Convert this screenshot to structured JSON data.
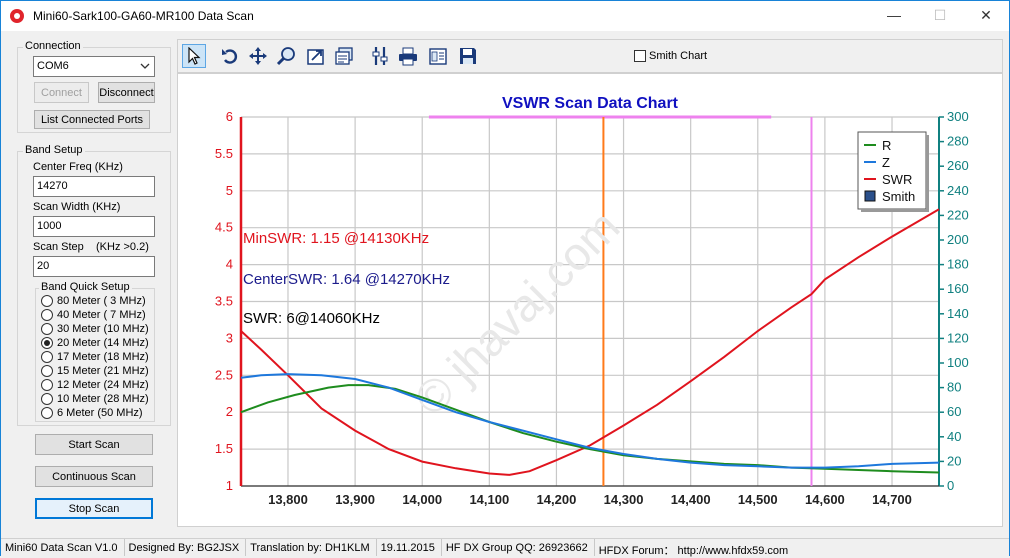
{
  "window": {
    "title": "Mini60-Sark100-GA60-MR100 Data Scan",
    "minimize_glyph": "—",
    "maximize_glyph": "☐",
    "close_glyph": "✕"
  },
  "connection": {
    "group_title": "Connection",
    "port_value": "COM6",
    "connect_label": "Connect",
    "disconnect_label": "Disconnect",
    "list_ports_label": "List Connected Ports"
  },
  "band_setup": {
    "group_title": "Band Setup",
    "center_freq_label": "Center Freq  (KHz)",
    "center_freq_value": "14270",
    "scan_width_label": "Scan Width   (KHz)",
    "scan_width_value": "1000",
    "scan_step_label": "Scan Step",
    "scan_step_hint": "(KHz >0.2)",
    "scan_step_value": "20",
    "quick_title": "Band Quick Setup",
    "bands": [
      {
        "label": "80 Meter (  3 MHz)",
        "selected": false
      },
      {
        "label": "40 Meter (  7 MHz)",
        "selected": false
      },
      {
        "label": "30 Meter (10 MHz)",
        "selected": false
      },
      {
        "label": "20 Meter (14 MHz)",
        "selected": true
      },
      {
        "label": "17 Meter (18 MHz)",
        "selected": false
      },
      {
        "label": "15 Meter (21 MHz)",
        "selected": false
      },
      {
        "label": "12 Meter (24 MHz)",
        "selected": false
      },
      {
        "label": "10 Meter (28 MHz)",
        "selected": false
      },
      {
        "label": "6 Meter  (50 MHz)",
        "selected": false
      }
    ]
  },
  "actions": {
    "start_scan": "Start Scan",
    "continuous_scan": "Continuous Scan",
    "stop_scan": "Stop Scan"
  },
  "toolbar": {
    "icons": [
      "pointer-icon",
      "undo-icon",
      "pan-icon",
      "zoom-icon",
      "export-icon",
      "properties-icon",
      "tools-icon",
      "print-icon",
      "page-setup-icon",
      "save-icon"
    ],
    "smith_chart_label": "Smith Chart",
    "smith_chart_checked": false
  },
  "chart_data": {
    "type": "line",
    "title": "VSWR Scan Data Chart",
    "title_color": "#1010c0",
    "xlim": [
      13730,
      14770
    ],
    "x_ticks": [
      "13,800",
      "13,900",
      "14,000",
      "14,100",
      "14,200",
      "14,300",
      "14,400",
      "14,500",
      "14,600",
      "14,700"
    ],
    "x_tick_values": [
      13800,
      13900,
      14000,
      14100,
      14200,
      14300,
      14400,
      14500,
      14600,
      14700
    ],
    "y_left_lim": [
      1,
      6
    ],
    "y_left_ticks": [
      "1",
      "1.5",
      "2",
      "2.5",
      "3",
      "3.5",
      "4",
      "4.5",
      "5",
      "5.5",
      "6"
    ],
    "y_left_color": "#e0141e",
    "y_right_lim": [
      0,
      300
    ],
    "y_right_ticks": [
      "0",
      "20",
      "40",
      "60",
      "80",
      "100",
      "120",
      "140",
      "160",
      "180",
      "200",
      "220",
      "240",
      "260",
      "280",
      "300"
    ],
    "y_right_color": "#108080",
    "grid": true,
    "legend_position": "top-right",
    "legend": [
      {
        "name": "R",
        "color": "#1e8c1e",
        "kind": "line"
      },
      {
        "name": "Z",
        "color": "#1e78dc",
        "kind": "line"
      },
      {
        "name": "SWR",
        "color": "#e0141e",
        "kind": "line"
      },
      {
        "name": "Smith",
        "color": "#2a4f8a",
        "kind": "box"
      }
    ],
    "annotations": [
      {
        "text": "MinSWR: 1.15 @14130KHz",
        "color": "#e0141e"
      },
      {
        "text": "CenterSWR: 1.64 @14270KHz",
        "color": "#1c1c8c"
      },
      {
        "text": "SWR: 6@14060KHz",
        "color": "#000000"
      }
    ],
    "markers": [
      {
        "x": 13730,
        "color": "#e0141e"
      },
      {
        "x": 14270,
        "color": "#ff7a1a"
      },
      {
        "x": 14580,
        "color": "#ee82ee"
      }
    ],
    "top_band": {
      "from": 14010,
      "to": 14520,
      "color": "#ee82ee"
    },
    "watermark": "© jhavaj.com",
    "series": [
      {
        "name": "SWR",
        "axis": "left",
        "color": "#e0141e",
        "x": [
          13730,
          13760,
          13800,
          13850,
          13900,
          13950,
          14000,
          14050,
          14100,
          14130,
          14160,
          14200,
          14250,
          14300,
          14350,
          14400,
          14450,
          14500,
          14550,
          14580,
          14600,
          14650,
          14700,
          14770
        ],
        "y": [
          3.1,
          2.85,
          2.5,
          2.05,
          1.75,
          1.5,
          1.33,
          1.24,
          1.17,
          1.15,
          1.2,
          1.35,
          1.55,
          1.82,
          2.1,
          2.42,
          2.75,
          3.1,
          3.42,
          3.6,
          3.8,
          4.1,
          4.38,
          4.75
        ]
      },
      {
        "name": "R",
        "axis": "right",
        "color": "#1e8c1e",
        "x": [
          13730,
          13770,
          13810,
          13860,
          13890,
          13920,
          13960,
          14000,
          14050,
          14100,
          14150,
          14200,
          14250,
          14300,
          14350,
          14400,
          14450,
          14500,
          14550,
          14600,
          14650,
          14700,
          14770
        ],
        "y": [
          60,
          68,
          74,
          80,
          82,
          82,
          79,
          72,
          62,
          52,
          43,
          36,
          30,
          25,
          22,
          20,
          18,
          17,
          15,
          14,
          13,
          12,
          11
        ]
      },
      {
        "name": "Z",
        "axis": "right",
        "color": "#1e78dc",
        "x": [
          13730,
          13760,
          13800,
          13850,
          13900,
          13950,
          14000,
          14050,
          14100,
          14150,
          14200,
          14250,
          14300,
          14350,
          14400,
          14450,
          14500,
          14550,
          14600,
          14650,
          14700,
          14770
        ],
        "y": [
          88,
          90,
          91,
          90,
          87,
          80,
          70,
          60,
          52,
          45,
          38,
          31,
          26,
          22,
          19,
          17,
          16,
          15,
          15,
          16,
          18,
          19
        ]
      }
    ]
  },
  "status": {
    "version": "Mini60 Data Scan V1.0",
    "designed": "Designed By: BG2JSX",
    "translation": "Translation by: DH1KLM",
    "date": "19.11.2015",
    "group": "HF DX Group QQ: 26923662",
    "forum": "HFDX Forum：  http://www.hfdx59.com"
  }
}
